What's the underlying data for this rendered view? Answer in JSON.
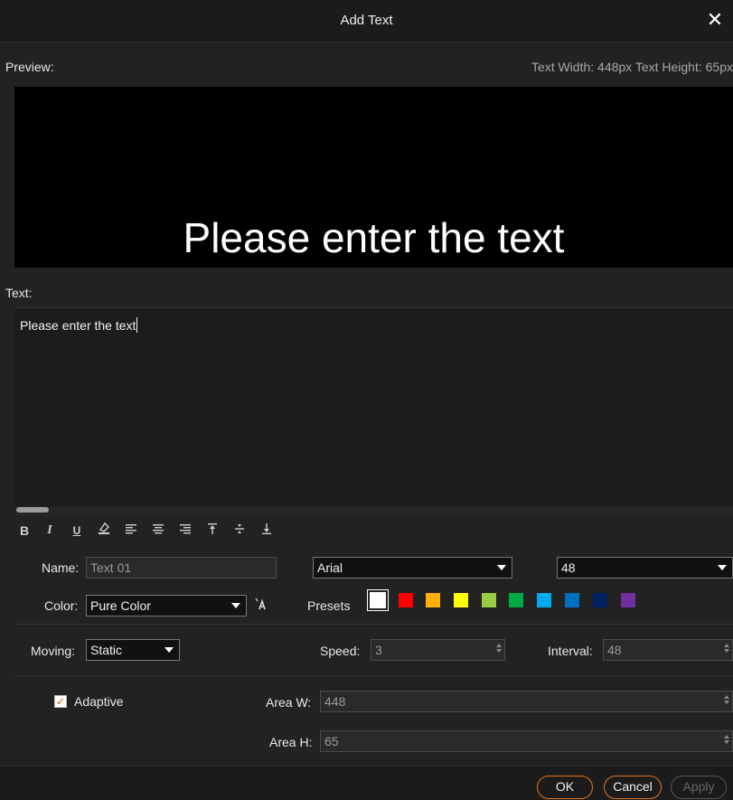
{
  "dialog": {
    "title": "Add Text"
  },
  "preview": {
    "label": "Preview:",
    "info": "Text Width: 448px Text Height: 65px",
    "text": "Please enter the text"
  },
  "text_section": {
    "label": "Text:",
    "value": "Please enter the text"
  },
  "toolbar": {
    "bold": "B",
    "italic": "I",
    "underline": "U",
    "align_left": "≡",
    "align_center": "≡",
    "align_right": "≡",
    "valign_top": "⊤",
    "valign_middle": "÷",
    "valign_bottom": "⊥"
  },
  "name": {
    "label": "Name:",
    "placeholder": "Text 01"
  },
  "font": {
    "family": "Arial",
    "size": "48"
  },
  "color": {
    "label": "Color:",
    "mode": "Pure Color",
    "presets_label": "Presets"
  },
  "preset_colors": [
    "#ffffff",
    "#ff0000",
    "#ffb000",
    "#ffff00",
    "#99cc44",
    "#00aa44",
    "#00aaee",
    "#0070c0",
    "#002060",
    "#7030a0"
  ],
  "moving": {
    "label": "Moving:",
    "value": "Static"
  },
  "speed": {
    "label": "Speed:",
    "value": "3"
  },
  "interval": {
    "label": "Interval:",
    "value": "48"
  },
  "adaptive": {
    "label": "Adaptive",
    "checked": true
  },
  "area_w": {
    "label": "Area W:",
    "value": "448"
  },
  "area_h": {
    "label": "Area H:",
    "value": "65"
  },
  "buttons": {
    "ok": "OK",
    "cancel": "Cancel",
    "apply": "Apply"
  }
}
